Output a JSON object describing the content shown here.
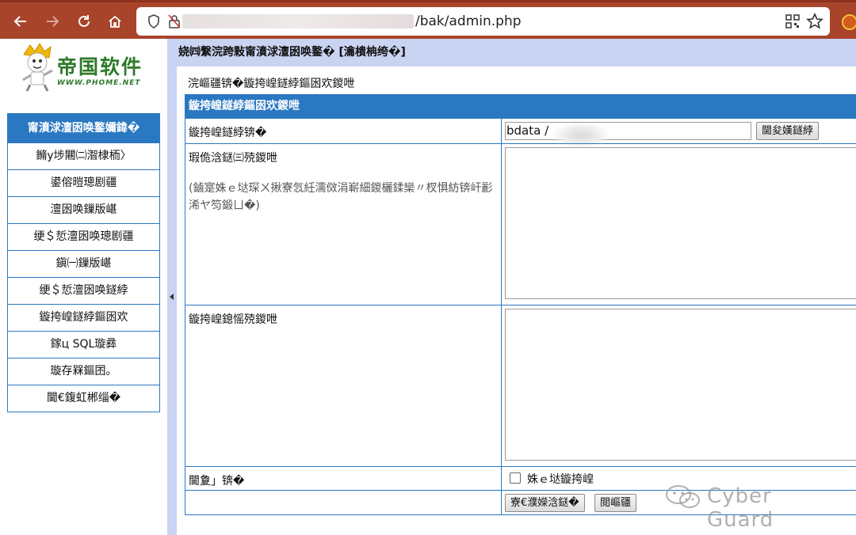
{
  "browser": {
    "url_suffix": "/bak/admin.php"
  },
  "brand": {
    "name": "帝国软件",
    "url": "WWW.PHOME.NET"
  },
  "sidebar": {
    "header": "甯濆浗澶囦唤鐜嬭鍏�",
    "items": [
      {
        "label": "鏅y埗闀㈡潪棣栭〉"
      },
      {
        "label": "鍙傛暟璁剧疆"
      },
      {
        "label": "澶囦唤鏁版嵁"
      },
      {
        "label": "绠＄悊澶囦唤璁剧疆"
      },
      {
        "label": "鎭㈠鏁版嵁"
      },
      {
        "label": "绠＄悊澶囦唤鐩綍"
      },
      {
        "label": "鏇挎崲鐩綍鏂囦欢"
      },
      {
        "label": "鎵ц SQL璇彞"
      },
      {
        "label": "璇存槑鏂囨。"
      },
      {
        "label": "閫€鍑虹郴缁�"
      }
    ]
  },
  "page": {
    "header": "娆㈣繋浣跨敤甯濆浗澶囦唤鐜� [瀹樻柟绔�]",
    "notice": "浣嶇疆锛�鏇挎崲鐩綍鏂囦欢鍐呭",
    "form_title": "鏇挎崲鐩綍鏂囦欢鍐呭",
    "fields": {
      "dir_label": "鏇挎崲鐩綍锛�",
      "dir_value": "bdata /",
      "dir_button": "閫夋嫨鐩綍",
      "find_label": "瑕佹浛鎹㈢殑鍐呭",
      "find_hint": "(鏀寔姝ｅ垯琛ㄨ揪寮忥紝濡傚涓嶄細鍐欐鍒欒〃杈惧紡锛屽彲浠ヤ笉鍛ㄩ�)",
      "replace_label": "鏇挎崲鎴愮殑鍐呭",
      "option_label": "閫夐」锛�",
      "option_checkbox": "姝ｅ垯鏇挎崲",
      "submit_button": "寮€濮嬫浛鎹�",
      "reset_button": "閲嶇疆"
    }
  },
  "watermark": {
    "text": "Cyber Guard"
  }
}
